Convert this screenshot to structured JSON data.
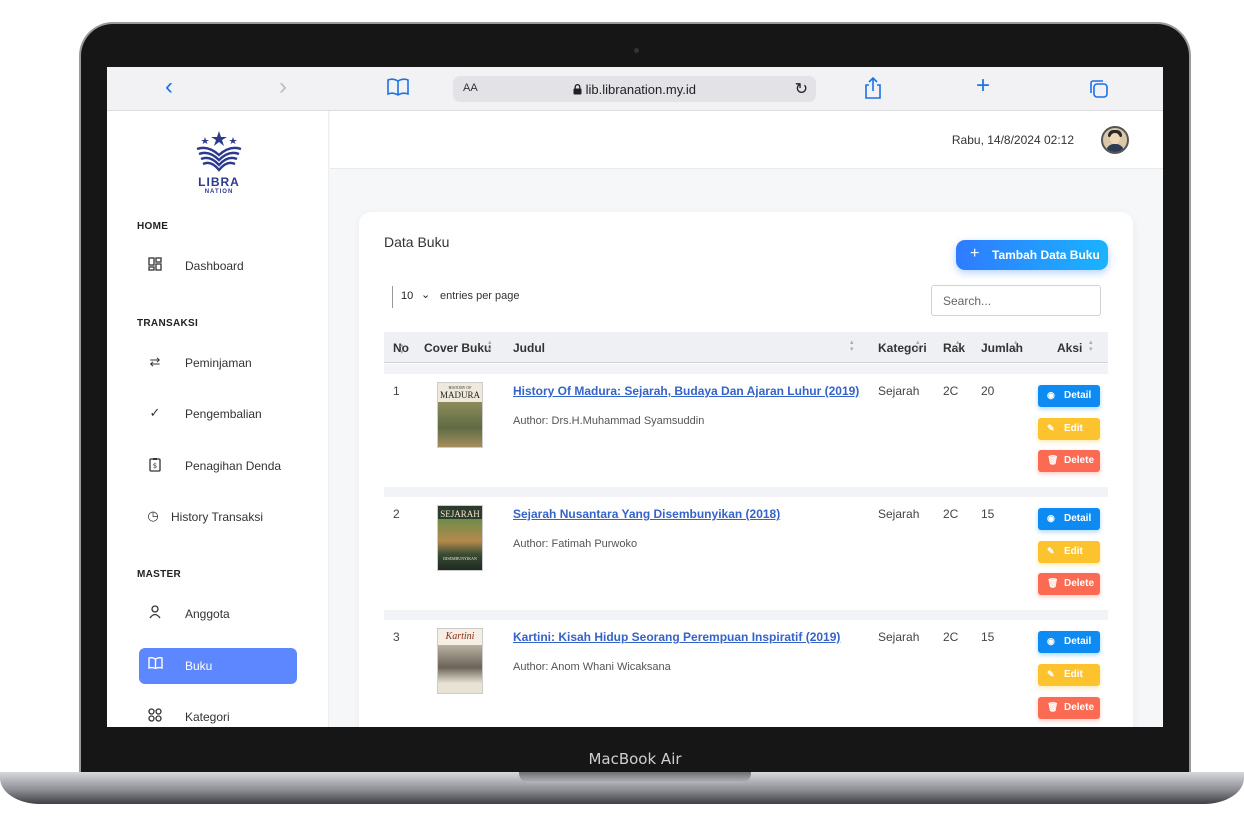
{
  "device": {
    "label": "MacBook Air"
  },
  "browser": {
    "back_icon": "‹",
    "forward_icon": "›",
    "reader_text": "AA",
    "url": "lib.libranation.my.id",
    "icons": [
      "back-icon",
      "forward-icon",
      "book-icon",
      "lock-icon",
      "reload-icon",
      "share-icon",
      "plus-icon",
      "tabs-icon"
    ]
  },
  "sidebar": {
    "logo_text": "LIBRA",
    "logo_sub": "NATION",
    "sections": [
      {
        "label": "HOME"
      },
      {
        "label": "TRANSAKSI"
      },
      {
        "label": "MASTER"
      }
    ],
    "items": [
      {
        "label": "Dashboard",
        "icon": "dashboard-icon"
      },
      {
        "label": "Peminjaman",
        "icon": "transfer-icon"
      },
      {
        "label": "Pengembalian",
        "icon": "check-icon"
      },
      {
        "label": "Penagihan Denda",
        "icon": "invoice-icon"
      },
      {
        "label": "History Transaksi",
        "icon": "clock-icon"
      },
      {
        "label": "Anggota",
        "icon": "user-icon"
      },
      {
        "label": "Buku",
        "icon": "book-icon",
        "active": true
      },
      {
        "label": "Kategori",
        "icon": "category-icon"
      }
    ]
  },
  "header": {
    "datetime": "Rabu, 14/8/2024 02:12"
  },
  "card": {
    "title": "Data Buku",
    "add_button": "Tambah Data Buku",
    "entries_value": "10",
    "entries_label": "entries per page",
    "search_placeholder": "Search..."
  },
  "table": {
    "columns": [
      "No",
      "Cover Buku",
      "Judul",
      "Kategori",
      "Rak",
      "Jumlah",
      "Aksi"
    ],
    "rows": [
      {
        "no": "1",
        "cover_text": "MADURA",
        "cover_top": "HISTORY OF",
        "title": "History Of Madura: Sejarah, Budaya Dan Ajaran Luhur (2019)",
        "author": "Author: Drs.H.Muhammad Syamsuddin",
        "kategori": "Sejarah",
        "rak": "2C",
        "jumlah": "20"
      },
      {
        "no": "2",
        "cover_text": "SEJARAH",
        "cover_bottom": "DISEMBUNYIKAN",
        "title": "Sejarah Nusantara Yang Disembunyikan (2018)",
        "author": "Author: Fatimah Purwoko",
        "kategori": "Sejarah",
        "rak": "2C",
        "jumlah": "15"
      },
      {
        "no": "3",
        "cover_text": "Kartini",
        "title": "Kartini: Kisah Hidup Seorang Perempuan Inspiratif (2019)",
        "author": "Author: Anom Whani Wicaksana",
        "kategori": "Sejarah",
        "rak": "2C",
        "jumlah": "15"
      }
    ],
    "actions": {
      "detail": "Detail",
      "edit": "Edit",
      "delete": "Delete"
    }
  },
  "colors": {
    "primary": "#5d87ff",
    "detail": "#0d8bf2",
    "edit": "#fdc32f",
    "delete": "#fb6a52",
    "link": "#3563c9"
  }
}
